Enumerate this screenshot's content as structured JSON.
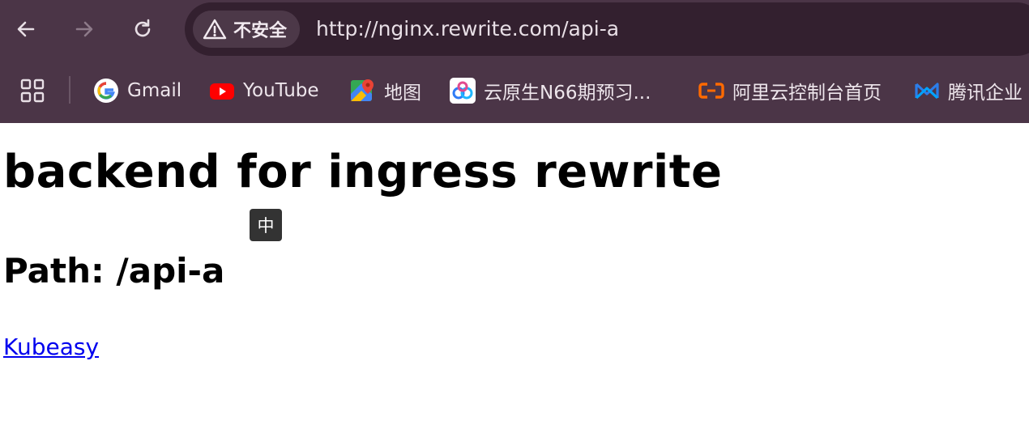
{
  "browser": {
    "nav": {
      "back": "back-arrow",
      "forward": "forward-arrow",
      "reload": "reload"
    },
    "omnibox": {
      "security_label": "不安全",
      "url": "http://nginx.rewrite.com/api-a"
    },
    "bookmarks": [
      {
        "label": "Gmail",
        "icon": "google-icon"
      },
      {
        "label": "YouTube",
        "icon": "youtube-icon"
      },
      {
        "label": "地图",
        "icon": "maps-icon"
      },
      {
        "label": "云原生N66期预习...",
        "icon": "baidu-netdisk-icon"
      },
      {
        "label": "阿里云控制台首页",
        "icon": "aliyun-icon"
      },
      {
        "label": "腾讯企业",
        "icon": "tencent-icon"
      }
    ],
    "colors": {
      "chrome_bg": "#4b3547",
      "omnibox_bg": "#33202f",
      "chip_bg": "#4c3848"
    }
  },
  "page": {
    "heading": "backend for ingress rewrite",
    "ime_indicator": "中",
    "path_heading": "Path: /api-a",
    "link": "Kubeasy",
    "link_color": "#0000ee"
  }
}
